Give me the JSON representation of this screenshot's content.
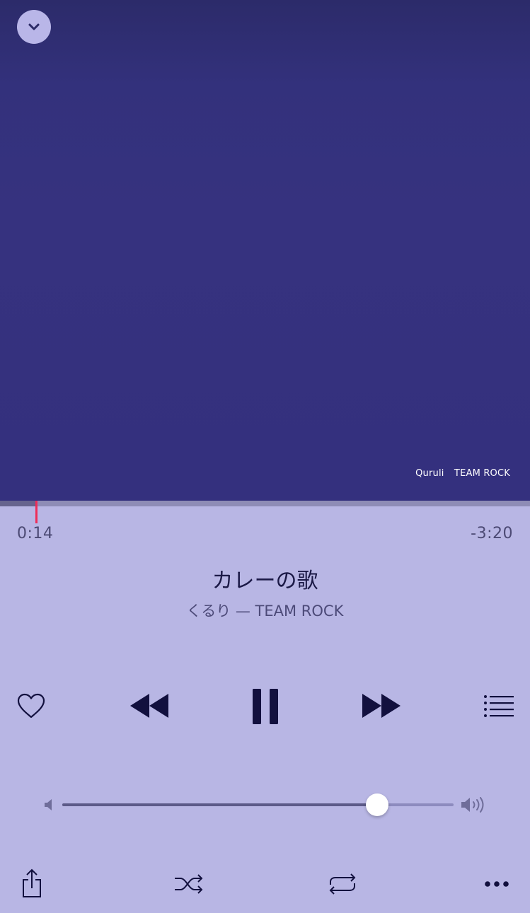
{
  "artwork": {
    "caption_artist": "Quruli",
    "caption_album": "TEAM ROCK"
  },
  "playback": {
    "elapsed": "0:14",
    "remaining": "-3:20",
    "progress_fraction": 0.068
  },
  "track": {
    "title": "カレーの歌",
    "subtitle": "くるり — TEAM ROCK"
  },
  "volume": {
    "level_fraction": 0.805
  },
  "controls": {
    "icons": [
      "heart-icon",
      "rewind-icon",
      "pause-icon",
      "fast-forward-icon",
      "queue-list-icon",
      "volume-low-icon",
      "volume-high-icon",
      "share-icon",
      "shuffle-icon",
      "repeat-icon",
      "more-icon",
      "chevron-down-icon"
    ]
  },
  "colors": {
    "artwork": "#35317e",
    "background": "#b8b6e4",
    "icon": "#12103e",
    "progress_head": "#ee2d58"
  }
}
